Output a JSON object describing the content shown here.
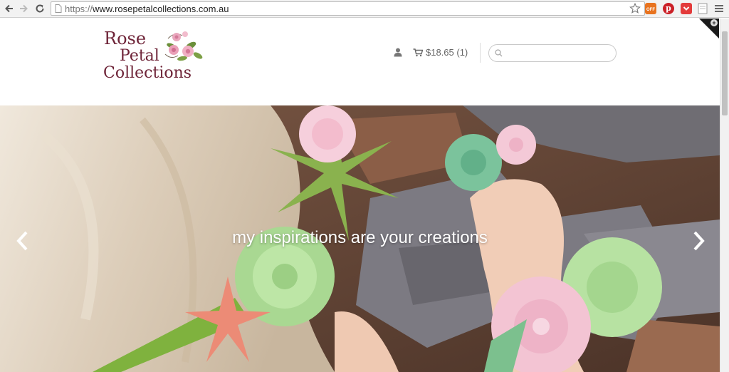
{
  "browser": {
    "url_scheme": "https://",
    "url_host": "www.rosepetalcollections.com.au",
    "extensions": [
      "star-icon",
      "sale-off-extension-icon",
      "pinterest-icon",
      "pocket-icon",
      "page-icon",
      "menu-icon"
    ],
    "extension_badge": "OFF"
  },
  "site": {
    "logo": {
      "line1": "Rose",
      "line2": "Petal",
      "line3": "Collections"
    },
    "cart_label": "$18.65 (1)",
    "search_placeholder": ""
  },
  "slider": {
    "caption": "my inspirations are your creations"
  },
  "colors": {
    "logo": "#6e2438",
    "header_text": "#666666",
    "caption": "#ffffff"
  }
}
